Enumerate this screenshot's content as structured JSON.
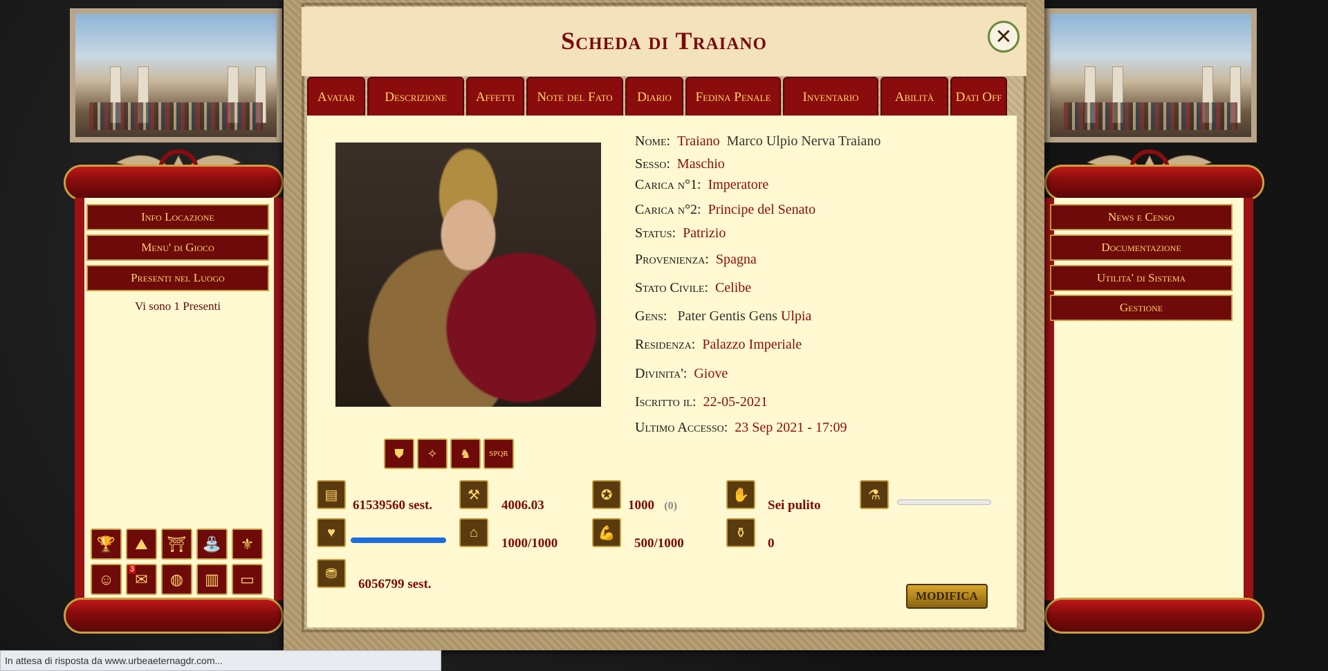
{
  "window": {
    "title": "Scheda di Traiano",
    "close_icon": "close-x-icon"
  },
  "tabs": [
    "Avatar",
    "Descrizione",
    "Affetti",
    "Note del Fato",
    "Diario",
    "Fedina Penale",
    "Inventario",
    "Abilità",
    "Dati Off"
  ],
  "left_menu": {
    "items": [
      "Info Locazione",
      "Menu' di Gioco",
      "Presenti nel Luogo"
    ],
    "present_text": "Vi sono 1 Presenti",
    "tile_badge": "3"
  },
  "right_menu": {
    "items": [
      "News e Censo",
      "Documentazione",
      "Utilita' di Sistema",
      "Gestione"
    ]
  },
  "profile": {
    "name_label": "Nome:",
    "name_value": "Traiano",
    "name_full": "Marco Ulpio Nerva Traiano",
    "sex_label": "Sesso:",
    "sex_value": "Maschio",
    "role1_label": "Carica n°1:",
    "role1_value": "Imperatore",
    "role2_label": "Carica n°2:",
    "role2_value": "Principe del Senato",
    "status_label": "Status:",
    "status_value": "Patrizio",
    "origin_label": "Provenienza:",
    "origin_value": "Spagna",
    "civil_label": "Stato Civile:",
    "civil_value": "Celibe",
    "gens_label": "Gens:",
    "gens_plain": "Pater Gentis Gens",
    "gens_value": "Ulpia",
    "residence_label": "Residenza:",
    "residence_value": "Palazzo Imperiale",
    "deity_label": "Divinita':",
    "deity_value": "Giove",
    "joined_label": "Iscritto il:",
    "joined_value": "22-05-2021",
    "last_label": "Ultimo Accesso:",
    "last_value": "23 Sep 2021 - 17:09"
  },
  "badges": [
    "shield-eagle-icon",
    "gold-eagle-icon",
    "chariot-icon",
    "spqr-icon"
  ],
  "badge_texts": {
    "spqr": "SPQR"
  },
  "stats": {
    "money": "61539560 sest.",
    "value2": "4006.03",
    "xp": "1000",
    "xp_extra": "(0)",
    "clean": "Sei pulito",
    "health": 1.0,
    "capacity": "1000/1000",
    "strength": "500/1000",
    "poison": "0",
    "bank": "6056799 sest.",
    "potion_level": 0.0
  },
  "buttons": {
    "modifica": "MODIFICA"
  },
  "statusbar": "In attesa di risposta da www.urbeaeternagdr.com...",
  "colors": {
    "accent": "#8a0c0c",
    "gold": "#ffd56a",
    "parchment": "#fff8d0",
    "health_bar": "#1a6fe0"
  }
}
